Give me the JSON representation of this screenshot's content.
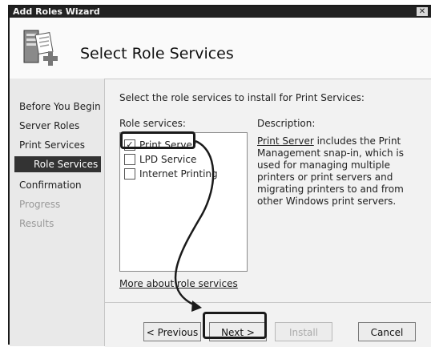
{
  "window": {
    "title": "Add Roles Wizard",
    "close_label": "✕"
  },
  "header": {
    "heading": "Select Role Services",
    "icon": "server-role-icon"
  },
  "sidebar": {
    "steps": [
      {
        "label": "Before You Begin",
        "state": "normal"
      },
      {
        "label": "Server Roles",
        "state": "normal"
      },
      {
        "label": "Print Services",
        "state": "normal"
      },
      {
        "label": "Role Services",
        "state": "active"
      },
      {
        "label": "Confirmation",
        "state": "normal"
      },
      {
        "label": "Progress",
        "state": "disabled"
      },
      {
        "label": "Results",
        "state": "disabled"
      }
    ]
  },
  "main": {
    "prompt": "Select the role services to install for Print Services:",
    "role_services_label": "Role services:",
    "description_label": "Description:",
    "items": [
      {
        "label": "Print Server",
        "checked": true,
        "check_glyph": "✓"
      },
      {
        "label": "LPD Service",
        "checked": false,
        "check_glyph": ""
      },
      {
        "label": "Internet Printing",
        "checked": false,
        "check_glyph": ""
      }
    ],
    "description_link": "Print Server",
    "description_text": " includes the Print Management snap-in, which is used for managing multiple printers or print servers and migrating printers to and from other Windows print servers.",
    "more_link": "More about role services"
  },
  "footer": {
    "previous": "< Previous",
    "next": "Next >",
    "install": "Install",
    "cancel": "Cancel"
  },
  "colors": {
    "highlight": "#1a1a1a",
    "active_step": "#333333"
  }
}
